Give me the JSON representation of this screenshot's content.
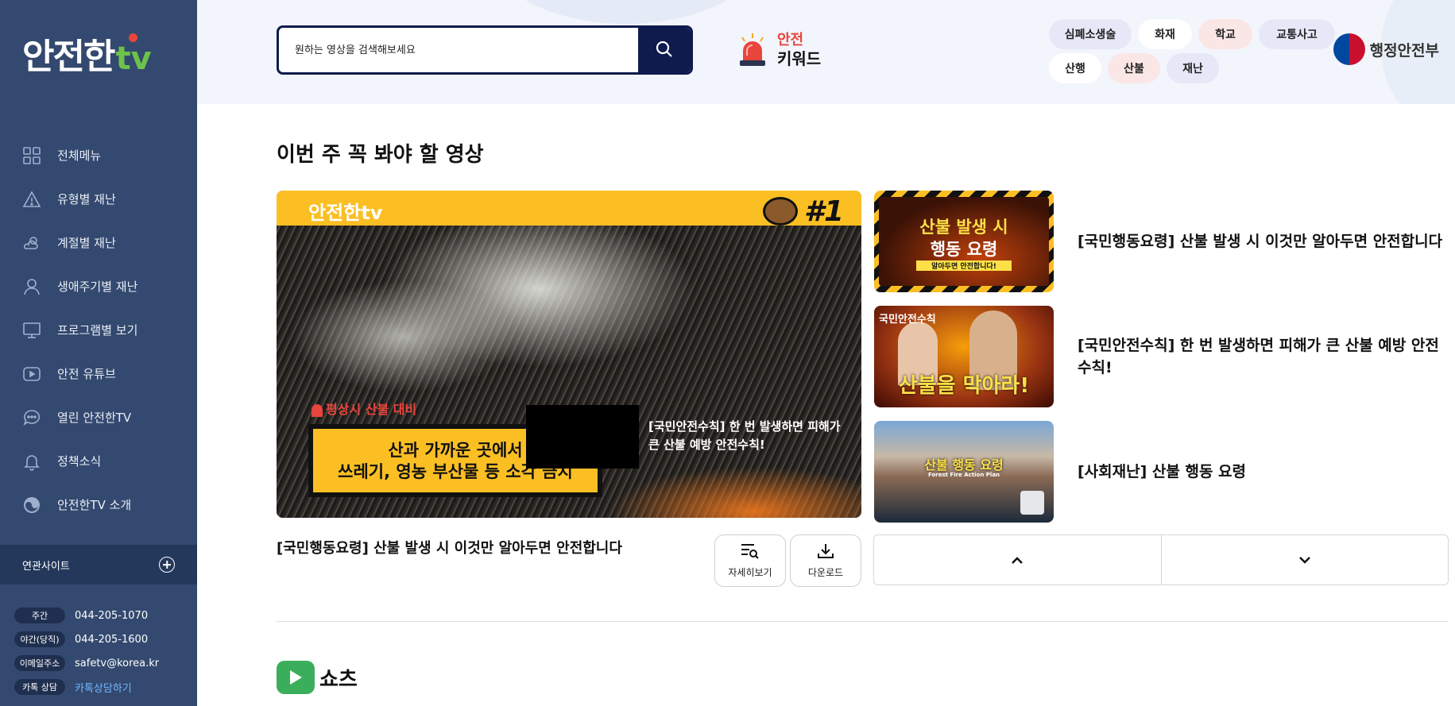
{
  "sidebar": {
    "logo_main": "안전한",
    "logo_tv": "tv",
    "items": [
      {
        "label": "전체메뉴",
        "icon": "grid-icon"
      },
      {
        "label": "유형별 재난",
        "icon": "warning-icon"
      },
      {
        "label": "계절별 재난",
        "icon": "weather-icon"
      },
      {
        "label": "생애주기별 재난",
        "icon": "person-icon"
      },
      {
        "label": "프로그램별 보기",
        "icon": "monitor-icon"
      },
      {
        "label": "안전 유튜브",
        "icon": "play-icon"
      },
      {
        "label": "열린 안전한TV",
        "icon": "chat-icon"
      },
      {
        "label": "정책소식",
        "icon": "bell-icon"
      },
      {
        "label": "안전한TV 소개",
        "icon": "logo-circle-icon"
      }
    ],
    "related_label": "연관사이트",
    "contacts": [
      {
        "tag": "주간",
        "value": "044-205-1070"
      },
      {
        "tag": "야간(당직)",
        "value": "044-205-1600"
      },
      {
        "tag": "이메일주소",
        "value": "safetv@korea.kr"
      },
      {
        "tag": "카톡 상담",
        "value": "카톡상담하기"
      }
    ]
  },
  "header": {
    "search_placeholder": "원하는 영상을 검색해보세요",
    "keyword_line1": "안전",
    "keyword_line2": "키워드",
    "chips": [
      "심폐소생술",
      "화재",
      "학교",
      "교통사고",
      "산행",
      "산불",
      "재난"
    ],
    "ministry": "행정안전부"
  },
  "main": {
    "section_title": "이번 주 꼭 봐야 할 영상",
    "feature": {
      "logo": "안전한tv",
      "rank": "#1",
      "alert_text": "평상시 산불 대비",
      "band_text_1": "산과 가까운 곳에서",
      "band_text_2": "쓰레기, 영농 부산물 등 소각 금지",
      "caption": "[국민안전수칙] 한 번 발생하면 피해가 큰 산불 예방 안전수칙!",
      "title": "[국민행동요령] 산불 발생 시 이것만 알아두면 안전합니다",
      "detail_label": "자세히보기",
      "download_label": "다운로드"
    },
    "side_items": [
      {
        "title": "[국민행동요령] 산불 발생 시 이것만 알아두면 안전합니다",
        "thumb_text_1": "산불 발생 시",
        "thumb_text_2": "행동 요령",
        "thumb_sub": "알아두면 안전합니다!"
      },
      {
        "title": "[국민안전수칙] 한 번 발생하면 피해가 큰 산불 예방 안전수칙!",
        "thumb_text_1": "국민안전수칙",
        "thumb_text_2": "산불을 막아라!",
        "thumb_sub": ""
      },
      {
        "title": "[사회재난] 산불 행동 요령",
        "thumb_text_1": "산불 행동 요령",
        "thumb_text_2": "Forest Fire Action Plan",
        "thumb_sub": ""
      }
    ],
    "shorts_title": "쇼츠"
  }
}
